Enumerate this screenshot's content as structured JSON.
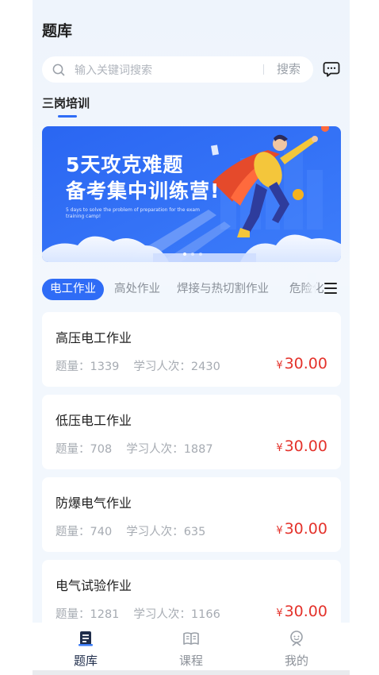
{
  "page": {
    "title": "题库"
  },
  "search": {
    "placeholder": "输入关键词搜索",
    "button_label": "搜索",
    "icon": "search-icon"
  },
  "header": {
    "message_icon": "chat-bubble-icon"
  },
  "category": {
    "label": "三岗培训"
  },
  "banner": {
    "title_line1": "5天攻克难题",
    "title_line2": "备考集中训练营!",
    "subtitle": "5 days to solve the problem of preparation for the exam training camp!",
    "carousel_dots": 3,
    "active_dot": 0
  },
  "tabs": {
    "items": [
      "电工作业",
      "高处作业",
      "焊接与热切割作业",
      "危险化"
    ],
    "active_index": 0,
    "menu_icon": "menu-icon"
  },
  "courses": [
    {
      "title": "高压电工作业",
      "count_label": "题量：",
      "count": "1339",
      "learners_label": "学习人次：",
      "learners": "2430",
      "currency": "¥",
      "price": "30.00"
    },
    {
      "title": "低压电工作业",
      "count_label": "题量：",
      "count": "708",
      "learners_label": "学习人次：",
      "learners": "1887",
      "currency": "¥",
      "price": "30.00"
    },
    {
      "title": "防爆电气作业",
      "count_label": "题量：",
      "count": "740",
      "learners_label": "学习人次：",
      "learners": "635",
      "currency": "¥",
      "price": "30.00"
    },
    {
      "title": "电气试验作业",
      "count_label": "题量：",
      "count": "1281",
      "learners_label": "学习人次：",
      "learners": "1166",
      "currency": "¥",
      "price": "30.00"
    }
  ],
  "tabbar": {
    "items": [
      {
        "label": "题库",
        "icon": "question-bank-icon",
        "active": true
      },
      {
        "label": "课程",
        "icon": "book-icon",
        "active": false
      },
      {
        "label": "我的",
        "icon": "profile-icon",
        "active": false
      }
    ]
  },
  "colors": {
    "accent": "#2f6cf6",
    "price": "#e4322b",
    "background": "#f2f7fd"
  }
}
